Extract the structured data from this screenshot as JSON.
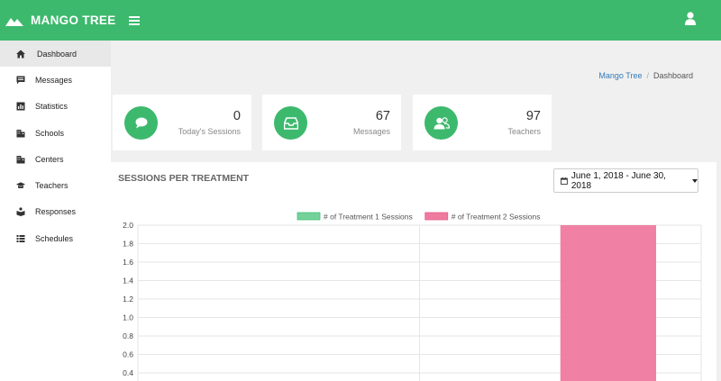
{
  "app": {
    "name": "MANGO TREE"
  },
  "sidebar": {
    "items": [
      {
        "label": "Dashboard",
        "icon": "home-icon",
        "active": true
      },
      {
        "label": "Messages",
        "icon": "message-icon"
      },
      {
        "label": "Statistics",
        "icon": "bar-chart-icon"
      },
      {
        "label": "Schools",
        "icon": "building-icon"
      },
      {
        "label": "Centers",
        "icon": "building-icon"
      },
      {
        "label": "Teachers",
        "icon": "graduation-cap-icon"
      },
      {
        "label": "Responses",
        "icon": "reading-icon"
      },
      {
        "label": "Schedules",
        "icon": "list-icon"
      }
    ]
  },
  "breadcrumb": {
    "root": "Mango Tree",
    "current": "Dashboard"
  },
  "stats": [
    {
      "value": "0",
      "label": "Today's Sessions",
      "icon": "chat-bubble-icon"
    },
    {
      "value": "67",
      "label": "Messages",
      "icon": "inbox-icon"
    },
    {
      "value": "97",
      "label": "Teachers",
      "icon": "users-icon"
    }
  ],
  "chart_panel": {
    "title": "SESSIONS PER TREATMENT",
    "date_range": "June 1, 2018 - June 30, 2018"
  },
  "colors": {
    "brand": "#3cb96d",
    "series1": "#74d19a",
    "series2": "#ef7aa0"
  },
  "chart_data": {
    "type": "bar",
    "categories": [
      "",
      ""
    ],
    "series": [
      {
        "name": "# of Treatment 1 Sessions",
        "values": [
          0,
          0
        ]
      },
      {
        "name": "# of Treatment 2 Sessions",
        "values": [
          null,
          2
        ]
      }
    ],
    "ylim": [
      0,
      2
    ],
    "yticks": [
      "2.0",
      "1.8",
      "1.6",
      "1.4",
      "1.2",
      "1.0",
      "0.8",
      "0.6",
      "0.4"
    ],
    "legend": "top"
  }
}
